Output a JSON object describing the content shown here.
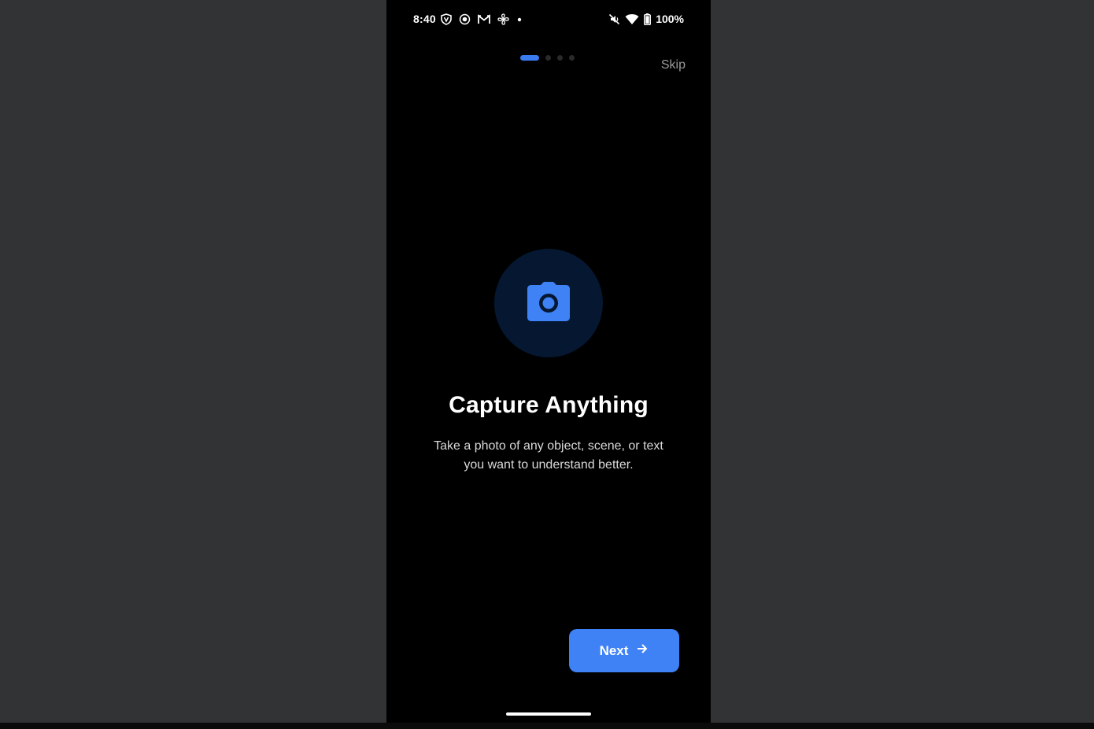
{
  "status_bar": {
    "time": "8:40",
    "battery_percent": "100%",
    "icons_left": [
      "vpn-shield-icon",
      "record-icon",
      "gmail-icon",
      "fan-icon",
      "dot-icon"
    ],
    "icons_right": [
      "mute-icon",
      "wifi-icon",
      "battery-icon"
    ]
  },
  "onboarding": {
    "skip_label": "Skip",
    "page_count": 4,
    "current_page": 1,
    "hero_icon": "camera-icon",
    "title": "Capture Anything",
    "subtitle": "Take a photo of any object, scene, or text you want to understand better.",
    "next_label": "Next",
    "next_icon": "arrow-right-icon"
  },
  "colors": {
    "accent": "#3e82f5",
    "hero_circle": "#051731",
    "background": "#000000",
    "backdrop": "#323335"
  }
}
